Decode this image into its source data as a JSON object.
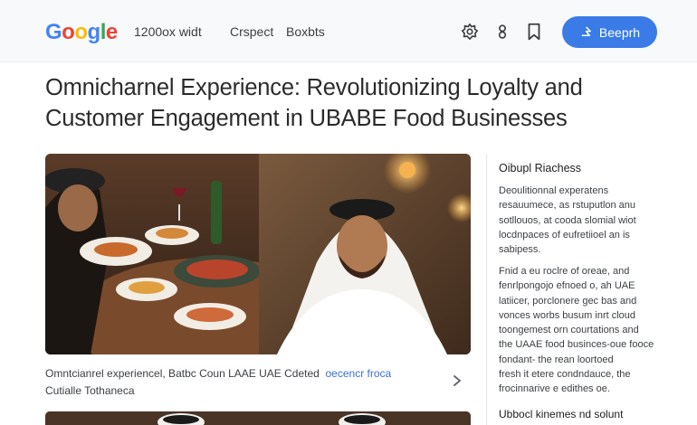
{
  "topbar": {
    "logo_text": "Google",
    "logo_letters": [
      "G",
      "o",
      "o",
      "g",
      "l",
      "e"
    ],
    "logo_colors": [
      "#4285f4",
      "#ea4335",
      "#fbbc05",
      "#4285f4",
      "#34a853",
      "#ea4335"
    ],
    "nav": [
      "1200ox widt",
      "Crspect",
      "Boxbts"
    ],
    "icons": [
      "gear-icon",
      "pin-icon",
      "bookmark-icon"
    ],
    "search_label": "Beeprh",
    "search_icon": "spark-icon",
    "accent_color": "#3a7be8"
  },
  "article": {
    "headline_line1": "Omnicharnel Experience: Revolutionizing Loyalty and",
    "headline_line2": "Customer Engagement in UBABE Food Businesses",
    "caption_line1": "Omntcianrel experiencel, Batbc Coun LAAE UAE Cdeted",
    "caption_accent": "oecencr froca",
    "caption_line2": "Cutialle Tothaneca"
  },
  "sidebar": {
    "title": "Oibupl Riachess",
    "para1": [
      "Deoulitionnal experatens",
      "resauumece, as rstuputlon anu",
      "sotllouos, at cooda slomial wiot",
      "locdnpaces of eufretiioel an is",
      "sabipess."
    ],
    "para2": [
      "Fnid a eu roclre of oreae, and",
      "fenrlpongojo efnoed o, ah UAE",
      "latiicer, porclonere gec bas and",
      "vonces worbs busum inrt cloud",
      "toongemest orn courtations and",
      "the UAAE food businces-oue fooce",
      "fondant- the rean loortoed",
      "fresh it etere condndauce, the",
      "frocinnarive e edithes oe."
    ],
    "subheading": "Ubbocl kinemes nd solunt"
  }
}
